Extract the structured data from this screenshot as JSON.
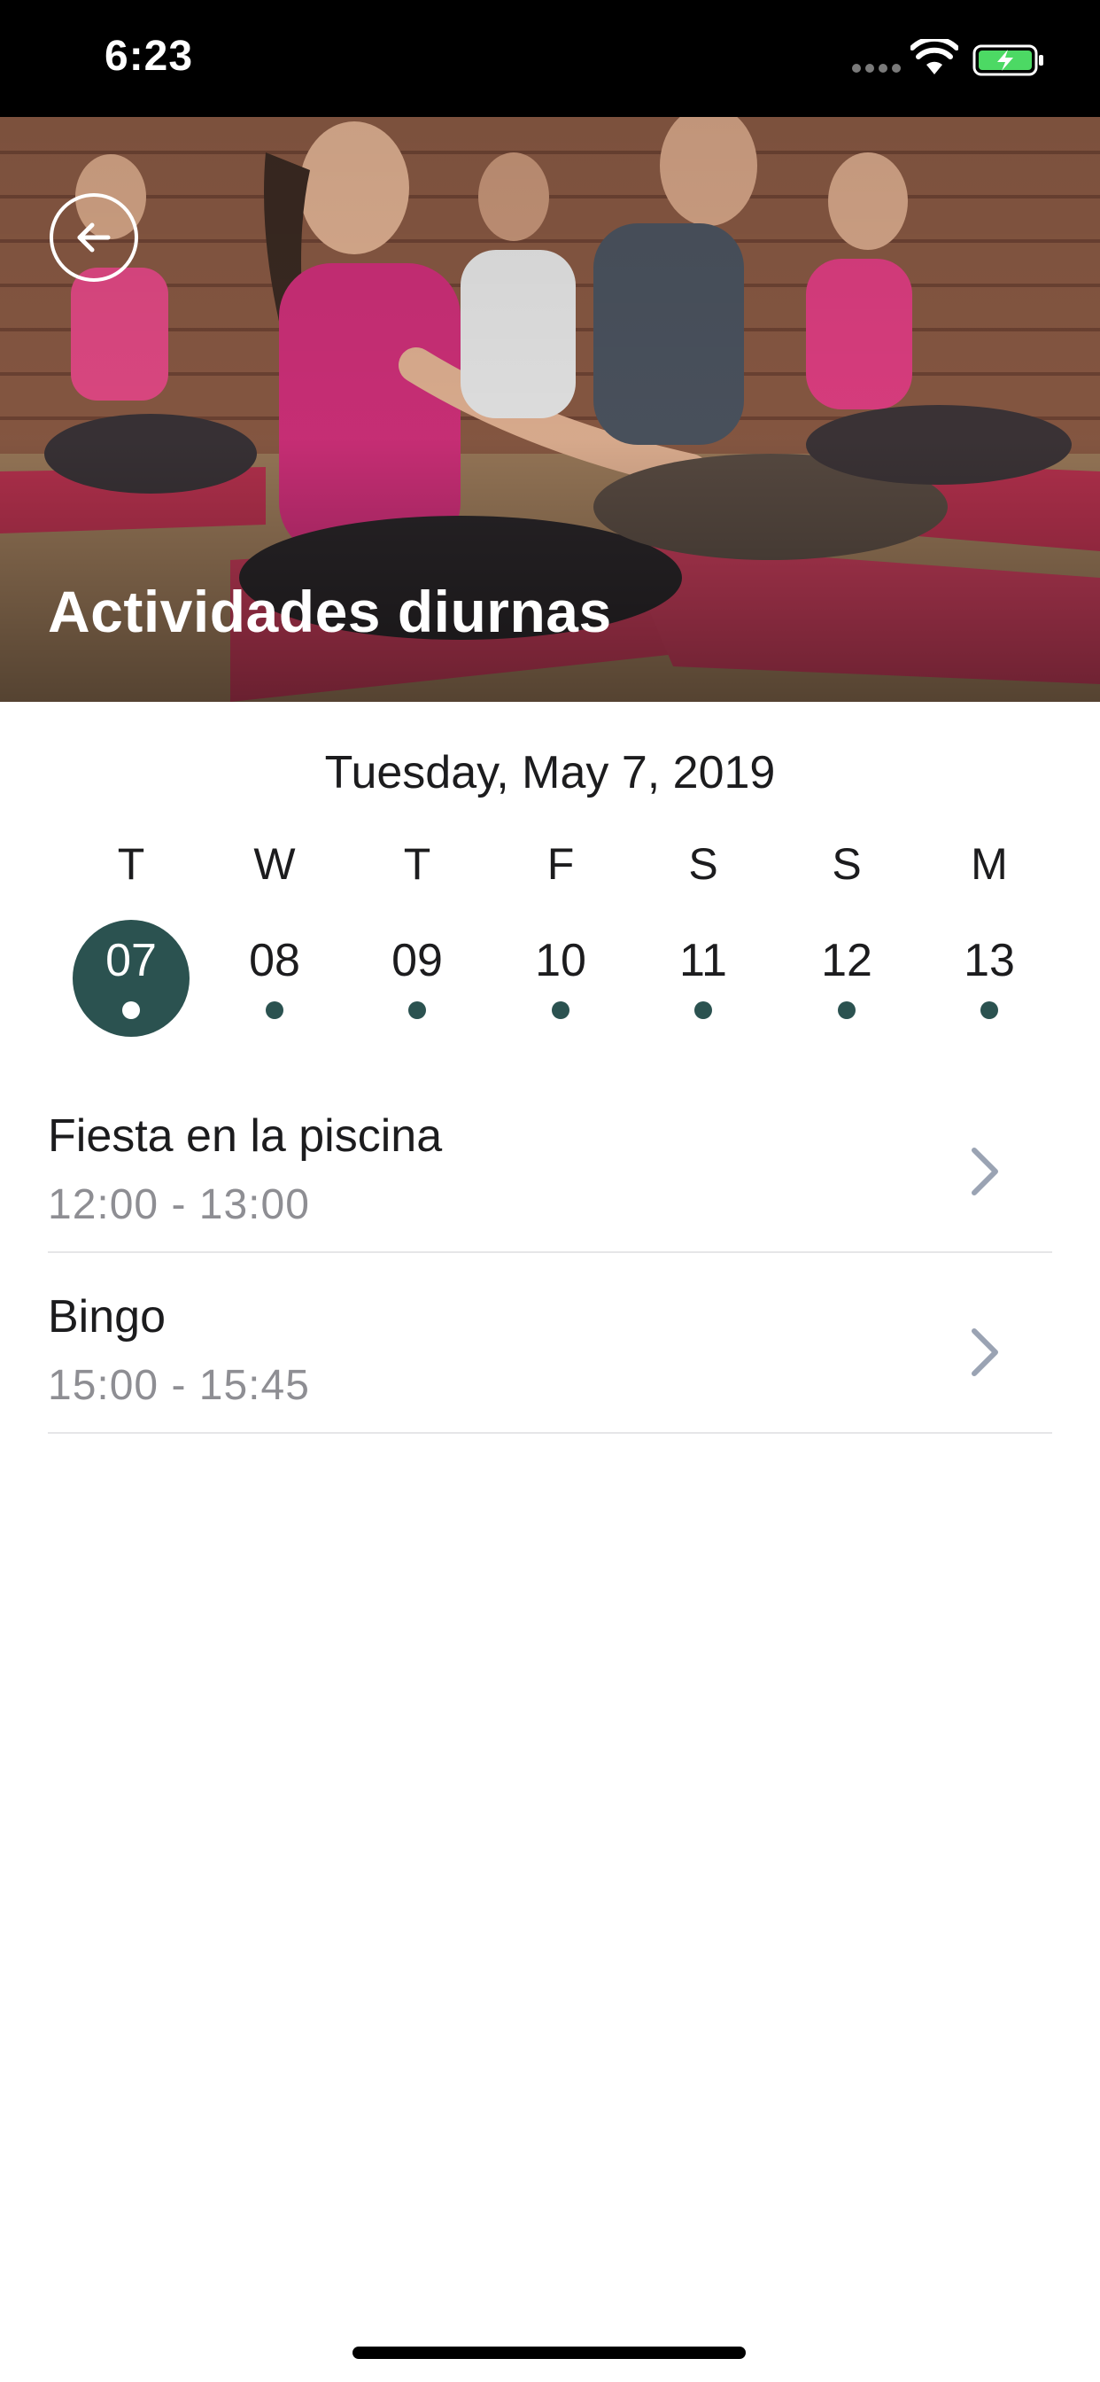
{
  "status_bar": {
    "time": "6:23",
    "icons": [
      "signal-icon",
      "wifi-icon",
      "battery-charging-icon"
    ],
    "battery_color": "#4cd964"
  },
  "hero": {
    "title": "Actividades diurnas",
    "back_icon": "arrow-left-circle-icon"
  },
  "calendar": {
    "date_label": "Tuesday, May 7, 2019",
    "accent_color": "#2b5250",
    "days": [
      {
        "letter": "T",
        "number": "07",
        "selected": true
      },
      {
        "letter": "W",
        "number": "08",
        "selected": false
      },
      {
        "letter": "T",
        "number": "09",
        "selected": false
      },
      {
        "letter": "F",
        "number": "10",
        "selected": false
      },
      {
        "letter": "S",
        "number": "11",
        "selected": false
      },
      {
        "letter": "S",
        "number": "12",
        "selected": false
      },
      {
        "letter": "M",
        "number": "13",
        "selected": false
      }
    ]
  },
  "activities": [
    {
      "name": "Fiesta en la piscina",
      "time": "12:00 - 13:00",
      "icon": "chevron-right-icon"
    },
    {
      "name": "Bingo",
      "time": "15:00 - 15:45",
      "icon": "chevron-right-icon"
    }
  ]
}
